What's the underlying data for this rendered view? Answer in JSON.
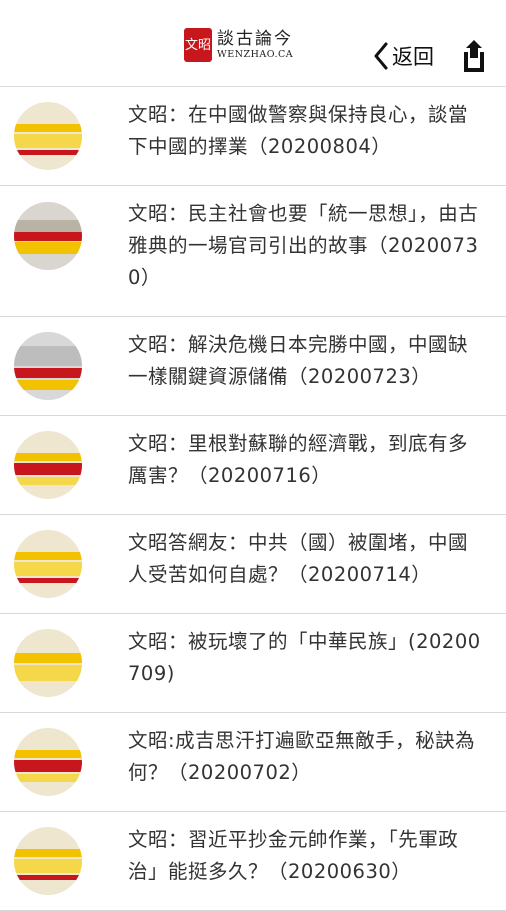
{
  "header": {
    "logo_seal": "文昭",
    "logo_title": "談古論今",
    "logo_subtitle": "WENZHAO.CA",
    "back_label": "返回",
    "back_icon": "chevron-left-icon",
    "share_icon": "share-icon"
  },
  "episodes": [
    {
      "title": "文昭：在中國做警察與保持良心，談當下中國的擇業（20200804）"
    },
    {
      "title": "文昭：民主社會也要「統一思想」，由古雅典的一場官司引出的故事（20200730）"
    },
    {
      "title": "文昭：解決危機日本完勝中國，中國缺一樣關鍵資源儲備（20200723）"
    },
    {
      "title": "文昭：里根對蘇聯的經濟戰，到底有多厲害？（20200716）"
    },
    {
      "title": "文昭答網友：中共（國）被圍堵，中國人受苦如何自處？（20200714）"
    },
    {
      "title": "文昭：被玩壞了的「中華民族」(20200709)"
    },
    {
      "title": "文昭:成吉思汗打遍歐亞無敵手，秘訣為何？（20200702）"
    },
    {
      "title": "文昭：習近平抄金元帥作業，「先軍政治」能挺多久？（20200630）"
    }
  ]
}
